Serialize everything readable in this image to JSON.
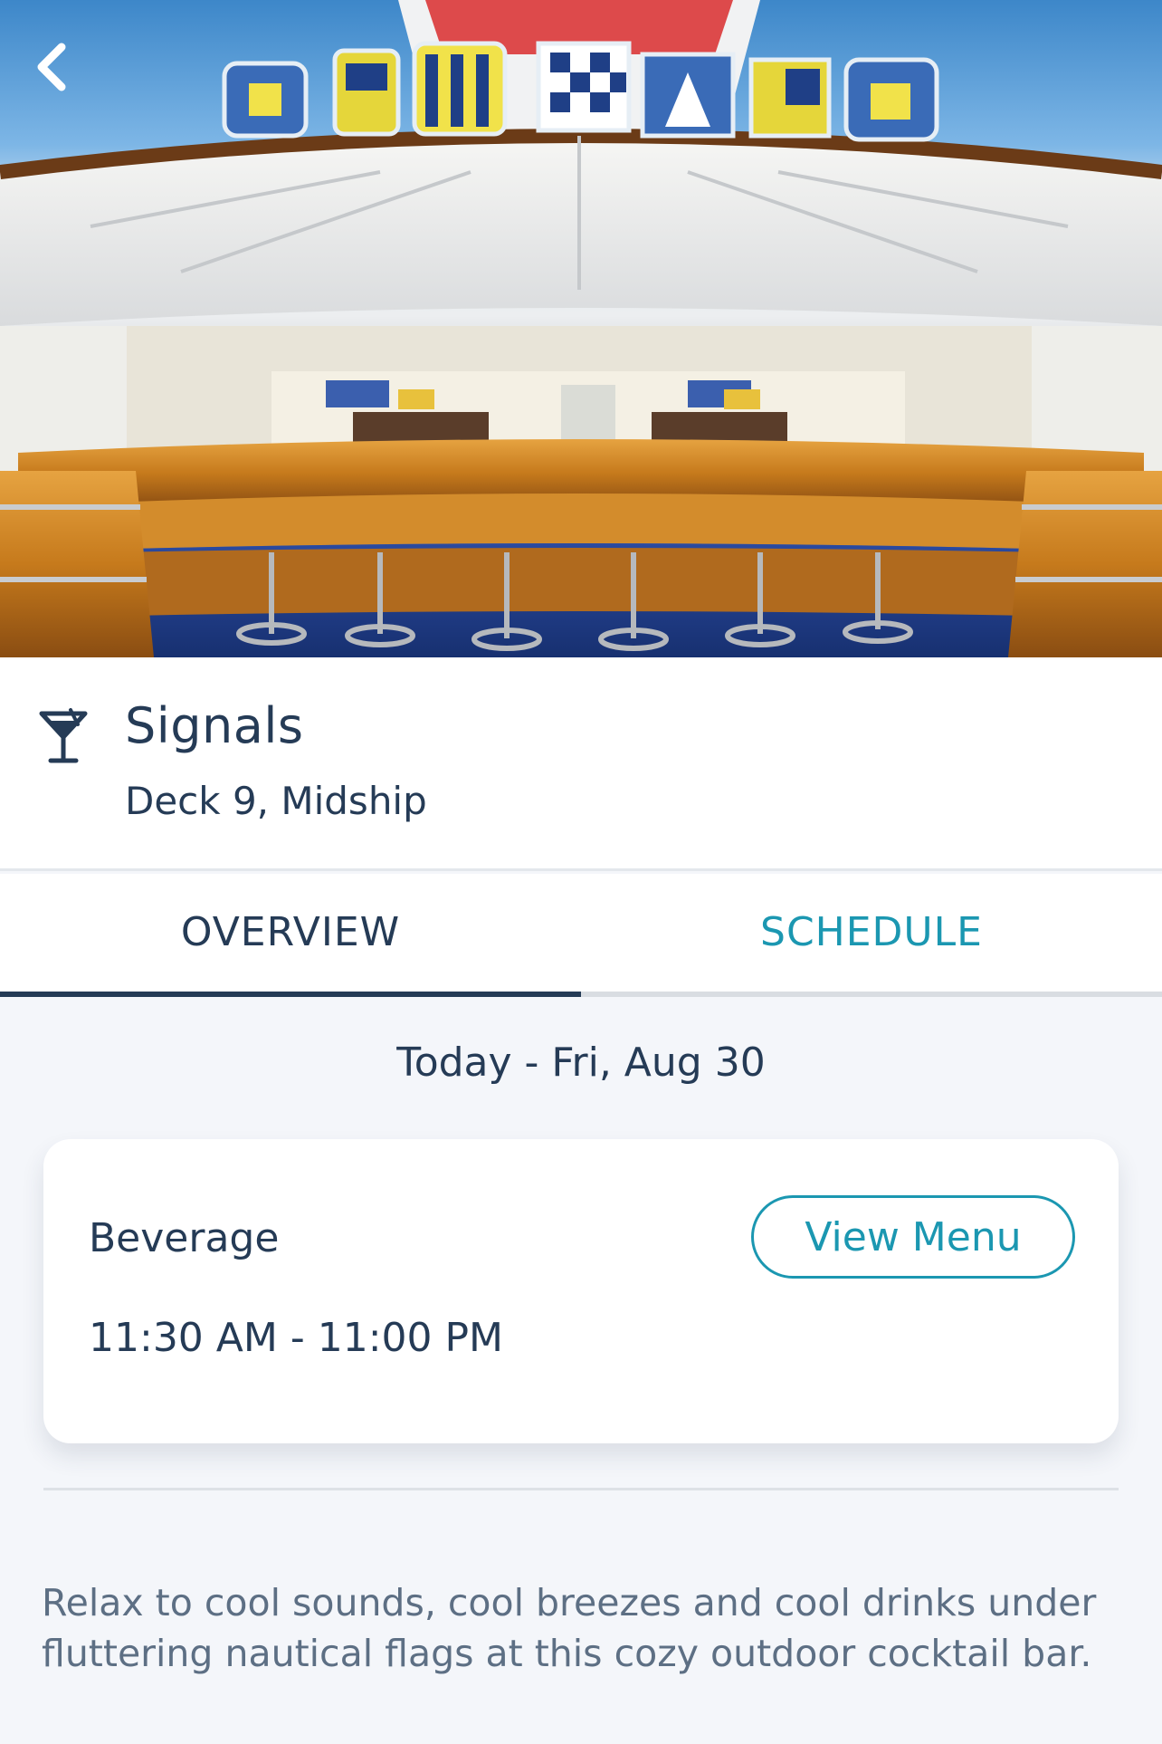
{
  "hero": {
    "sign_letters": "SIGNALS"
  },
  "header": {
    "title": "Signals",
    "subtitle": "Deck 9, Midship",
    "icon": "cocktail-glass-icon"
  },
  "tabs": [
    {
      "label": "OVERVIEW",
      "active": true
    },
    {
      "label": "SCHEDULE",
      "active": false
    }
  ],
  "schedule": {
    "date_label": "Today - Fri, Aug 30",
    "items": [
      {
        "type": "Beverage",
        "hours": "11:30 AM - 11:00 PM",
        "button_label": "View Menu"
      }
    ]
  },
  "description": "Relax to cool sounds, cool breezes and cool drinks under fluttering nautical flags at this cozy outdoor cocktail bar.",
  "colors": {
    "navy": "#253b56",
    "teal": "#1b97b1",
    "body_text": "#5d6f84",
    "background": "#f4f6fa"
  }
}
